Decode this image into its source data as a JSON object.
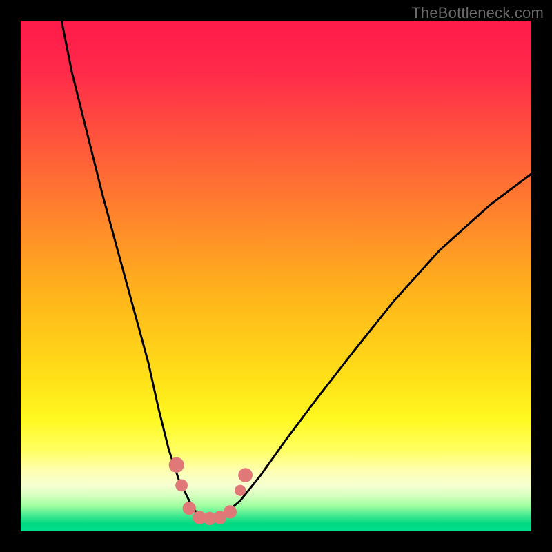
{
  "watermark": {
    "text": "TheBottleneck.com"
  },
  "chart_data": {
    "type": "line",
    "title": "",
    "xlabel": "",
    "ylabel": "",
    "xlim": [
      0,
      100
    ],
    "ylim": [
      0,
      100
    ],
    "grid": false,
    "legend": false,
    "series": [
      {
        "name": "bottleneck-curve",
        "x": [
          8,
          10,
          13,
          16,
          19,
          22,
          25,
          27,
          29,
          31,
          33,
          34.5,
          36,
          38,
          40,
          43,
          47,
          52,
          58,
          65,
          73,
          82,
          92,
          100
        ],
        "values": [
          100,
          90,
          78,
          66,
          55,
          44,
          33,
          24,
          16,
          10,
          6,
          3.5,
          2.5,
          2.5,
          3.5,
          6,
          11,
          18,
          26,
          35,
          45,
          55,
          64,
          70
        ]
      }
    ],
    "markers": [
      {
        "name": "marker-left-upper",
        "x": 30.5,
        "y": 13,
        "r": 1.5
      },
      {
        "name": "marker-left-mid",
        "x": 31.5,
        "y": 9,
        "r": 1.2
      },
      {
        "name": "marker-left-start",
        "x": 33,
        "y": 4.5,
        "r": 1.3
      },
      {
        "name": "marker-valley-1",
        "x": 35,
        "y": 2.7,
        "r": 1.3
      },
      {
        "name": "marker-valley-2",
        "x": 37,
        "y": 2.5,
        "r": 1.3
      },
      {
        "name": "marker-valley-3",
        "x": 39,
        "y": 2.7,
        "r": 1.3
      },
      {
        "name": "marker-right-end",
        "x": 41,
        "y": 3.8,
        "r": 1.3
      },
      {
        "name": "marker-right-mid",
        "x": 43,
        "y": 8,
        "r": 1.1
      },
      {
        "name": "marker-right-upper",
        "x": 44,
        "y": 11,
        "r": 1.4
      }
    ],
    "colors": {
      "curve_stroke": "#000000",
      "marker_fill": "#e07878",
      "gradient_top": "#ff1a4a",
      "gradient_bottom": "#00e090"
    }
  }
}
